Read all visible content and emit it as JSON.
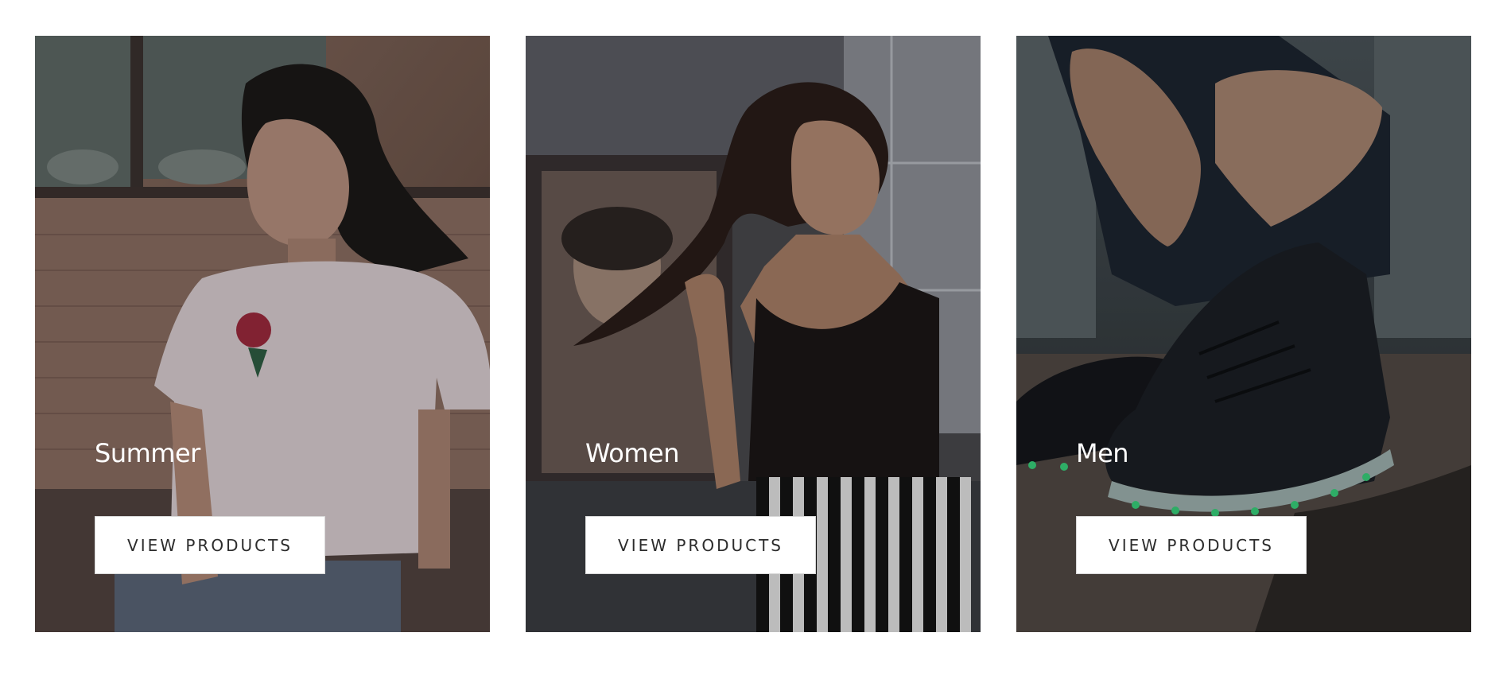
{
  "collections": [
    {
      "title": "Summer",
      "button_label": "VIEW PRODUCTS",
      "image": "woman-white-tshirt-rose-photo"
    },
    {
      "title": "Women",
      "button_label": "VIEW PRODUCTS",
      "image": "woman-black-top-striped-pants-photo"
    },
    {
      "title": "Men",
      "button_label": "VIEW PRODUCTS",
      "image": "man-tying-led-sneakers-photo"
    }
  ]
}
